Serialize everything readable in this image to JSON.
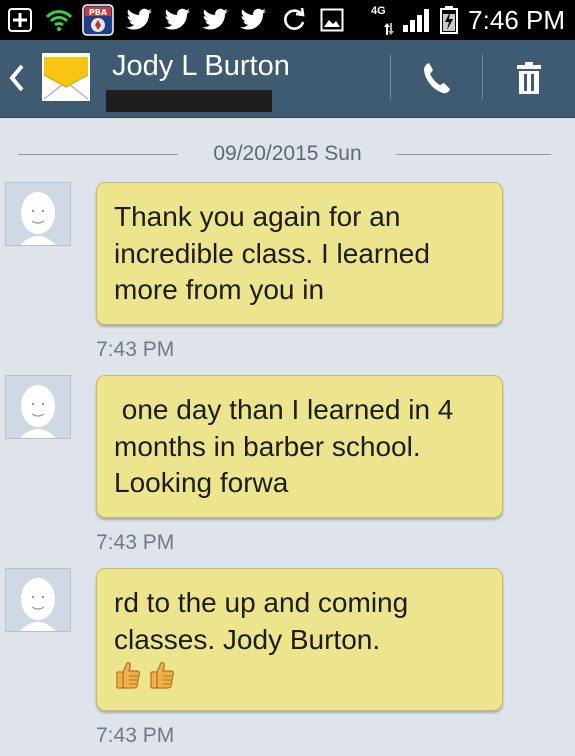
{
  "status_bar": {
    "time": "7:46 PM",
    "network": "4G",
    "icons": [
      "add-notification-icon",
      "wifi-icon",
      "pba-app-icon",
      "twitter-icon",
      "twitter-icon",
      "twitter-icon",
      "twitter-icon",
      "sync-icon",
      "image-icon",
      "signal-icon",
      "battery-icon"
    ]
  },
  "header": {
    "contact_name": "Jody L Burton",
    "accent": "#3f5b72"
  },
  "conversation": {
    "date": "09/20/2015 Sun",
    "messages": [
      {
        "text": "Thank you again for an\nincredible class. I learned\nmore from you in",
        "time": "7:43 PM"
      },
      {
        "text": " one day than I learned in 4\nmonths in barber school.\nLooking forwa",
        "time": "7:43 PM"
      },
      {
        "text": "rd to the up and coming\nclasses. Jody Burton.",
        "time": "7:43 PM",
        "emoji": [
          "thumbs-up",
          "thumbs-up"
        ]
      }
    ]
  },
  "colors": {
    "bubble": "#ede58d",
    "background": "#dfe4ea"
  }
}
